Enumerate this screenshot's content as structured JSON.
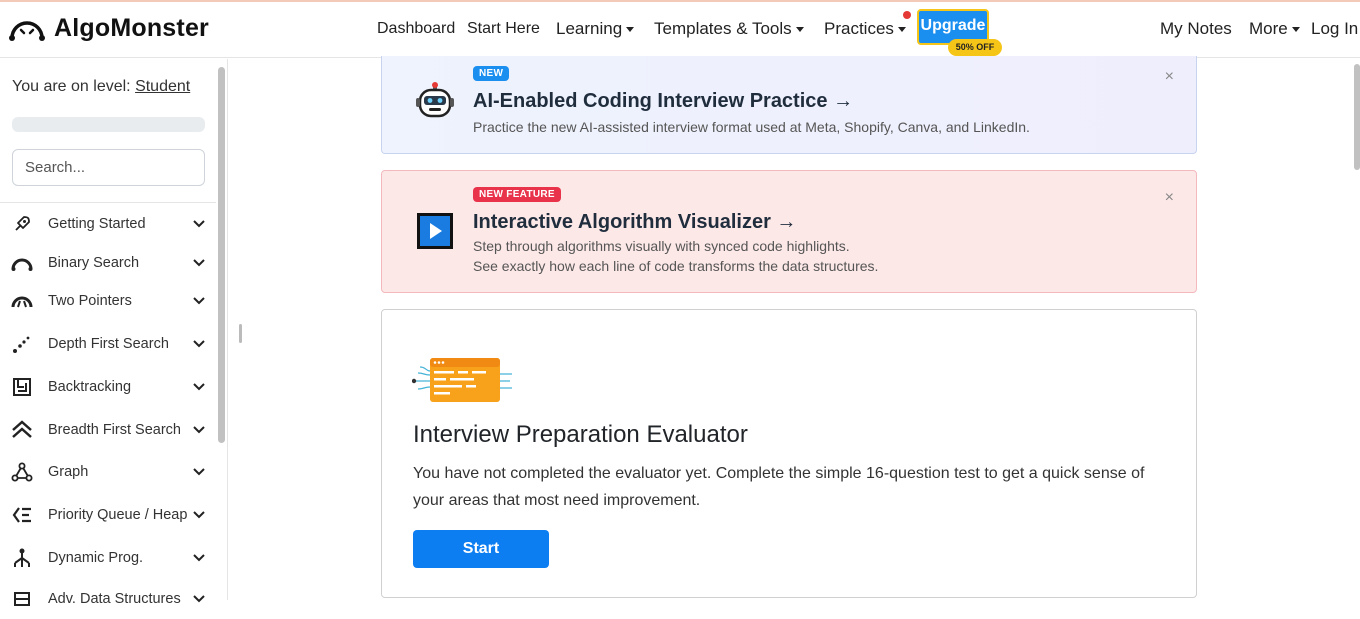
{
  "app": {
    "logo_text": "AlgoMonster"
  },
  "nav": {
    "dashboard": "Dashboard",
    "start_here": "Start Here",
    "learning": "Learning",
    "templates_tools": "Templates & Tools",
    "practices": "Practices",
    "upgrade": "Upgrade",
    "upgrade_badge": "50% OFF",
    "my_notes": "My Notes",
    "more": "More",
    "login": "Log In"
  },
  "sidebar": {
    "level_prefix": "You are on level:",
    "level_name": "Student",
    "progress_fraction": 0,
    "search_placeholder": "Search...",
    "items": [
      {
        "label": "Getting Started",
        "icon": "rocket-icon"
      },
      {
        "label": "Binary Search",
        "icon": "binary-search-icon"
      },
      {
        "label": "Two Pointers",
        "icon": "two-pointers-icon"
      },
      {
        "label": "Depth First Search",
        "icon": "dfs-icon"
      },
      {
        "label": "Backtracking",
        "icon": "maze-icon"
      },
      {
        "label": "Breadth First Search",
        "icon": "bfs-icon"
      },
      {
        "label": "Graph",
        "icon": "graph-icon"
      },
      {
        "label": "Priority Queue / Heap",
        "icon": "priority-queue-icon"
      },
      {
        "label": "Dynamic Prog.",
        "icon": "dynamic-programming-icon"
      },
      {
        "label": "Adv. Data Structures",
        "icon": "data-structures-icon"
      }
    ]
  },
  "banners": {
    "ai": {
      "badge": "NEW",
      "title": "AI-Enabled Coding Interview Practice →",
      "subtitle": "Practice the new AI-assisted interview format used at Meta, Shopify, Canva, and LinkedIn.",
      "close": "×"
    },
    "visualizer": {
      "badge": "NEW FEATURE",
      "title": "Interactive Algorithm Visualizer →",
      "subtitle_line1": "Step through algorithms visually with synced code highlights.",
      "subtitle_line2": "See exactly how each line of code transforms the data structures.",
      "close": "×"
    }
  },
  "evaluator": {
    "title": "Interview Preparation Evaluator",
    "description": "You have not completed the evaluator yet. Complete the simple 16-question test to get a quick sense of your areas that most need improvement.",
    "button": "Start"
  },
  "colors": {
    "primary": "#1a8ff0",
    "upgrade_border": "#f5c518",
    "new_feature_badge": "#e8334a",
    "start_button": "#0d7df2"
  }
}
